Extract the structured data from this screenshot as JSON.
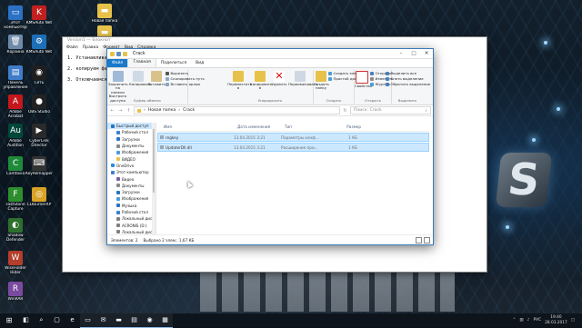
{
  "desktop": {
    "icons_left": [
      {
        "label": "Этот компьютер",
        "color": "#2b72c4",
        "glyph": "▭",
        "icon": "computer-icon"
      },
      {
        "label": "KMSAuto Net",
        "color": "#c21f1f",
        "glyph": "K",
        "icon": "kms-icon"
      },
      {
        "label": "Корзина",
        "color": "#6e8aa8",
        "glyph": "🗑",
        "icon": "recycle-bin-icon"
      },
      {
        "label": "KMSAuto Net",
        "color": "#1d6fb8",
        "glyph": "⚙",
        "icon": "kms-icon"
      },
      {
        "label": "Панель управления",
        "color": "#3f7cc9",
        "glyph": "▤",
        "icon": "control-panel-icon"
      },
      {
        "label": "Сеть",
        "color": "#1f1f1f",
        "glyph": "◉",
        "icon": "network-icon"
      },
      {
        "label": "Adobe Acrobat",
        "color": "#c4171b",
        "glyph": "A",
        "icon": "acrobat-icon"
      },
      {
        "label": "OBS Studio",
        "color": "#222222",
        "glyph": "●",
        "icon": "obs-icon"
      },
      {
        "label": "Adobe Audition",
        "color": "#00473a",
        "glyph": "Au",
        "icon": "audition-icon"
      },
      {
        "label": "CyberLink Director",
        "color": "#2a2a2a",
        "glyph": "▶",
        "icon": "cyberlink-icon"
      },
      {
        "label": "Camtasia",
        "color": "#1f8a3b",
        "glyph": "C",
        "icon": "camtasia-icon"
      },
      {
        "label": "KeyRemapper",
        "color": "#333333",
        "glyph": "⌨",
        "icon": "key-icon"
      },
      {
        "label": "FastStone Capture",
        "color": "#2d8e2d",
        "glyph": "F",
        "icon": "faststone-icon"
      },
      {
        "label": "CDBurnerXP",
        "color": "#d8a227",
        "glyph": "◎",
        "icon": "cdburner-icon"
      },
      {
        "label": "Shadow Defender",
        "color": "#2d6f2d",
        "glyph": "◐",
        "icon": "shadow-defender-icon"
      },
      {
        "label": "WiseFolder Hider",
        "color": "#b33e2b",
        "glyph": "W",
        "icon": "wise-icon"
      },
      {
        "label": "WinRAR",
        "color": "#7a4aa0",
        "glyph": "R",
        "icon": "winrar-icon"
      }
    ],
    "icons_top": [
      {
        "label": "Новая папка",
        "color": "#e7c24a",
        "glyph": "▬",
        "icon": "folder-icon"
      },
      {
        "label": "KMSAuto",
        "color": "#e7c24a",
        "glyph": "▬",
        "icon": "folder-icon"
      }
    ]
  },
  "notepad": {
    "title": "Version1 — Блокнот",
    "menu": [
      "Файл",
      "Правка",
      "Формат",
      "Вид",
      "Справка"
    ],
    "lines": [
      "1. Устанавливаем п",
      "2. копируем файлы",
      "3. Отключаемся от"
    ]
  },
  "explorer": {
    "title": "Crack",
    "tabs": [
      "Файл",
      "Главная",
      "Поделиться",
      "Вид"
    ],
    "ribbon": {
      "pin": "Закрепить на панели быстрого доступа",
      "copy": "Копировать",
      "paste": "Вставить",
      "cut": "Вырезать",
      "copy_path": "Скопировать путь",
      "paste_shortcut": "Вставить ярлык",
      "clipboard_group": "Буфер обмена",
      "move_to": "Переместить в",
      "copy_to": "Копировать в",
      "delete": "Удалить",
      "rename": "Переименовать",
      "organize_group": "Упорядочить",
      "new_folder": "Создать папку",
      "new_item": "Создать элемент",
      "easy_access": "Простой доступ",
      "create_group": "Создать",
      "open": "Открыть",
      "edit": "Изменить",
      "history": "Журнал",
      "properties": "Свойства",
      "open_group": "Открыть",
      "select_all": "Выделить все",
      "select_none": "Снять выделение",
      "invert_selection": "Обратить выделение",
      "select_group": "Выделить"
    },
    "address": [
      "Новая папка",
      "Crack"
    ],
    "search_placeholder": "Поиск: Crack",
    "nav": [
      {
        "label": "Быстрый доступ",
        "color": "#2b72c4",
        "sel": true,
        "sub": false
      },
      {
        "label": "Рабочий стол",
        "color": "#3b7fd0",
        "sel": false,
        "sub": true
      },
      {
        "label": "Загрузки",
        "color": "#2b72c4",
        "sel": false,
        "sub": true
      },
      {
        "label": "Документы",
        "color": "#8a8a8a",
        "sel": false,
        "sub": true
      },
      {
        "label": "Изображения",
        "color": "#4a9bd9",
        "sel": false,
        "sub": true
      },
      {
        "label": "ВИДЕО",
        "color": "#e7c24a",
        "sel": false,
        "sub": true
      },
      {
        "label": "OneDrive",
        "color": "#2b8ae0",
        "sel": false,
        "sub": false
      },
      {
        "label": "Этот компьютер",
        "color": "#3b7fd0",
        "sel": false,
        "sub": false
      },
      {
        "label": "Видео",
        "color": "#7a5aa8",
        "sel": false,
        "sub": true
      },
      {
        "label": "Документы",
        "color": "#8a8a8a",
        "sel": false,
        "sub": true
      },
      {
        "label": "Загрузки",
        "color": "#2b72c4",
        "sel": false,
        "sub": true
      },
      {
        "label": "Изображения",
        "color": "#4a9bd9",
        "sel": false,
        "sub": true
      },
      {
        "label": "Музыка",
        "color": "#2b72c4",
        "sel": false,
        "sub": true
      },
      {
        "label": "Рабочий стол",
        "color": "#3b7fd0",
        "sel": false,
        "sub": true
      },
      {
        "label": "Локальный дис",
        "color": "#7f7f7f",
        "sel": false,
        "sub": true
      },
      {
        "label": "ACRONIS (D:)",
        "color": "#7f7f7f",
        "sel": false,
        "sub": true
      },
      {
        "label": "Локальный дис",
        "color": "#7f7f7f",
        "sel": false,
        "sub": true
      }
    ],
    "columns": [
      "Имя",
      "Дата изменения",
      "Тип",
      "Размер"
    ],
    "files": [
      {
        "name": "regkey",
        "date": "13.04.2015 3:21",
        "type": "Параметры конф...",
        "size": "1 КБ",
        "color": "#9aa7b4"
      },
      {
        "name": "UpdaterDll.dll",
        "date": "13.04.2015 3:21",
        "type": "Расширение при...",
        "size": "1 КБ",
        "color": "#9aa7b4"
      }
    ],
    "status": {
      "count": "Элементов: 2",
      "selected": "Выбрано 2 элем.: 1,67 КБ"
    }
  },
  "taskbar": {
    "apps": [
      "◧",
      "⌕",
      "▢",
      "e",
      "▭",
      "✉",
      "▬",
      "▤",
      "◉",
      "▦"
    ],
    "clock_time": "19:40",
    "clock_date": "28.03.2017",
    "lang": "РУС"
  }
}
